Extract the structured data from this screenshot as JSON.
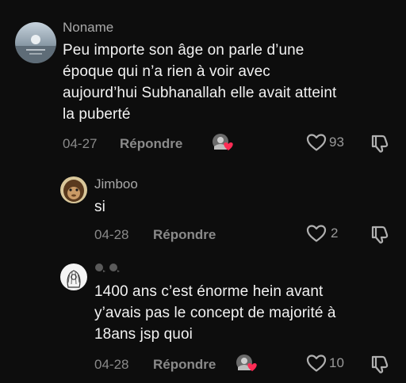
{
  "comments": [
    {
      "username": "Noname",
      "text_lines": [
        "Peu importe son âge on parle d’une",
        "époque qui n’a rien à voir avec",
        "aujourd’hui Subhanallah elle avait atteint",
        "la puberté"
      ],
      "date": "04-27",
      "reply_label": "Répondre",
      "like_count": "93",
      "liked_by_creator": true
    },
    {
      "username": "Jimboo",
      "text_lines": [
        "si"
      ],
      "date": "04-28",
      "reply_label": "Répondre",
      "like_count": "2",
      "liked_by_creator": false
    },
    {
      "username": "",
      "text_lines": [
        "1400 ans c’est énorme hein avant",
        "y’avais pas le concept de majorité à",
        "18ans jsp quoi"
      ],
      "date": "04-28",
      "reply_label": "Répondre",
      "like_count": "10",
      "liked_by_creator": true
    }
  ],
  "colors": {
    "background": "#0d0d0d",
    "heart_badge": "#fe2c55"
  }
}
